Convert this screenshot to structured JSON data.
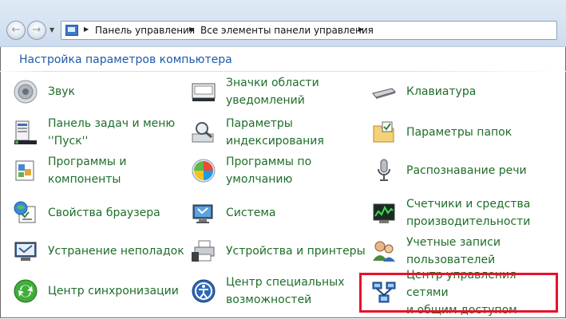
{
  "breadcrumb": {
    "items": [
      "Панель управления",
      "Все элементы панели управления"
    ]
  },
  "content": {
    "heading": "Настройка параметров компьютера"
  },
  "items": [
    {
      "label": "Звук",
      "icon": "speaker-icon"
    },
    {
      "label": "Значки области\nуведомлений",
      "icon": "tray-icon"
    },
    {
      "label": "Клавиатура",
      "icon": "keyboard-icon"
    },
    {
      "label": "Панель задач и меню\n''Пуск''",
      "icon": "taskbar-icon"
    },
    {
      "label": "Параметры\nиндексирования",
      "icon": "indexing-icon"
    },
    {
      "label": "Параметры папок",
      "icon": "folder-options-icon"
    },
    {
      "label": "Программы и\nкомпоненты",
      "icon": "programs-icon"
    },
    {
      "label": "Программы по\nумолчанию",
      "icon": "default-programs-icon"
    },
    {
      "label": "Распознавание речи",
      "icon": "microphone-icon"
    },
    {
      "label": "Свойства браузера",
      "icon": "internet-options-icon"
    },
    {
      "label": "Система",
      "icon": "system-icon"
    },
    {
      "label": "Счетчики и средства\nпроизводительности",
      "icon": "performance-icon"
    },
    {
      "label": "Устранение неполадок",
      "icon": "troubleshooting-icon"
    },
    {
      "label": "Устройства и принтеры",
      "icon": "printer-icon"
    },
    {
      "label": "Учетные записи\nпользователей",
      "icon": "users-icon"
    },
    {
      "label": "Центр синхронизации",
      "icon": "sync-icon"
    },
    {
      "label": "Центр специальных\nвозможностей",
      "icon": "accessibility-icon"
    },
    {
      "label": "Центр управления сетями\nи общим доступом",
      "icon": "network-icon"
    }
  ],
  "colors": {
    "link": "#1e6e2a",
    "heading": "#1e5aa8",
    "highlight": "#e8102b"
  }
}
